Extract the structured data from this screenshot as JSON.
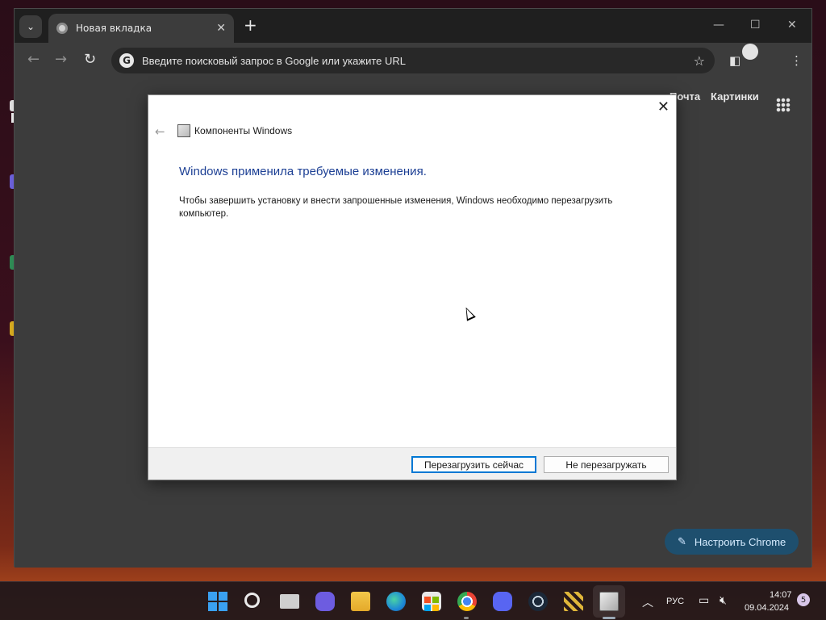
{
  "browser": {
    "tab_title": "Новая вкладка",
    "omnibox_placeholder": "Введите поисковый запрос в Google или укажите URL",
    "ntp_links": [
      "Почта",
      "Картинки"
    ],
    "customize_label": "Настроить Chrome"
  },
  "dialog": {
    "app_title": "Компоненты Windows",
    "heading": "Windows применила требуемые изменения.",
    "body": "Чтобы завершить установку и внести запрошенные изменения, Windows необходимо перезагрузить компьютер.",
    "restart_now_label": "Перезагрузить сейчас",
    "dont_restart_label": "Не перезагружать"
  },
  "taskbar": {
    "apps": [
      "start-icon",
      "search-icon",
      "task-view-icon",
      "meet-icon",
      "file-explorer-icon",
      "edge-icon",
      "store-icon",
      "chrome-icon",
      "discord-icon",
      "steam-icon",
      "app-icon",
      "windows-features-icon"
    ],
    "language": "РУС",
    "time": "14:07",
    "date": "09.04.2024",
    "notifications": "5"
  },
  "colors": {
    "heading_blue": "#1c3f94",
    "primary_button_border": "#0078d4",
    "customize_bg": "#1e4f6e"
  }
}
